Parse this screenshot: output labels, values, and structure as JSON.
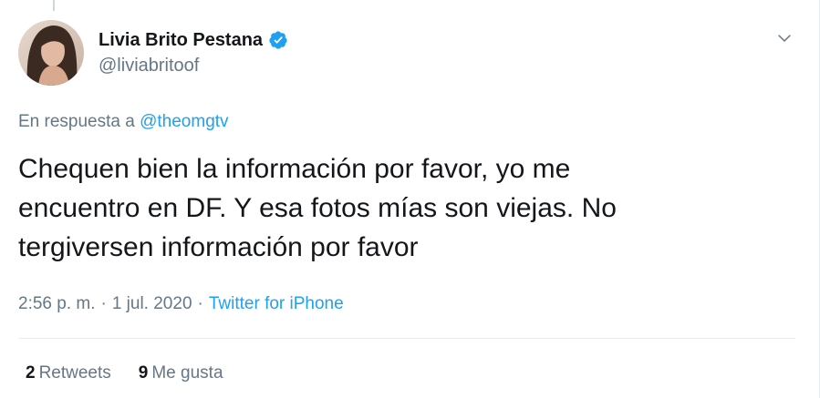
{
  "author": {
    "name": "Livia Brito Pestana",
    "handle": "@liviabritoof",
    "verified": true
  },
  "reply": {
    "prefix": "En respuesta a ",
    "mention": "@theomgtv"
  },
  "tweet": {
    "text": "Chequen bien la información por favor, yo me\nencuentro en DF. Y esa fotos mías son viejas. No\ntergiversen información por favor"
  },
  "meta": {
    "time": "2:56 p. m.",
    "separator1": "·",
    "date": "1 jul. 2020",
    "separator2": "·",
    "source": "Twitter for iPhone"
  },
  "stats": {
    "retweets_count": "2",
    "retweets_label": "Retweets",
    "likes_count": "9",
    "likes_label": "Me gusta"
  },
  "colors": {
    "accent": "#1da1f2",
    "text": "#14171a",
    "secondary": "#657786",
    "border": "#e6ecf0"
  },
  "icons": {
    "verified": "verified-badge-icon",
    "more": "chevron-down-icon"
  }
}
